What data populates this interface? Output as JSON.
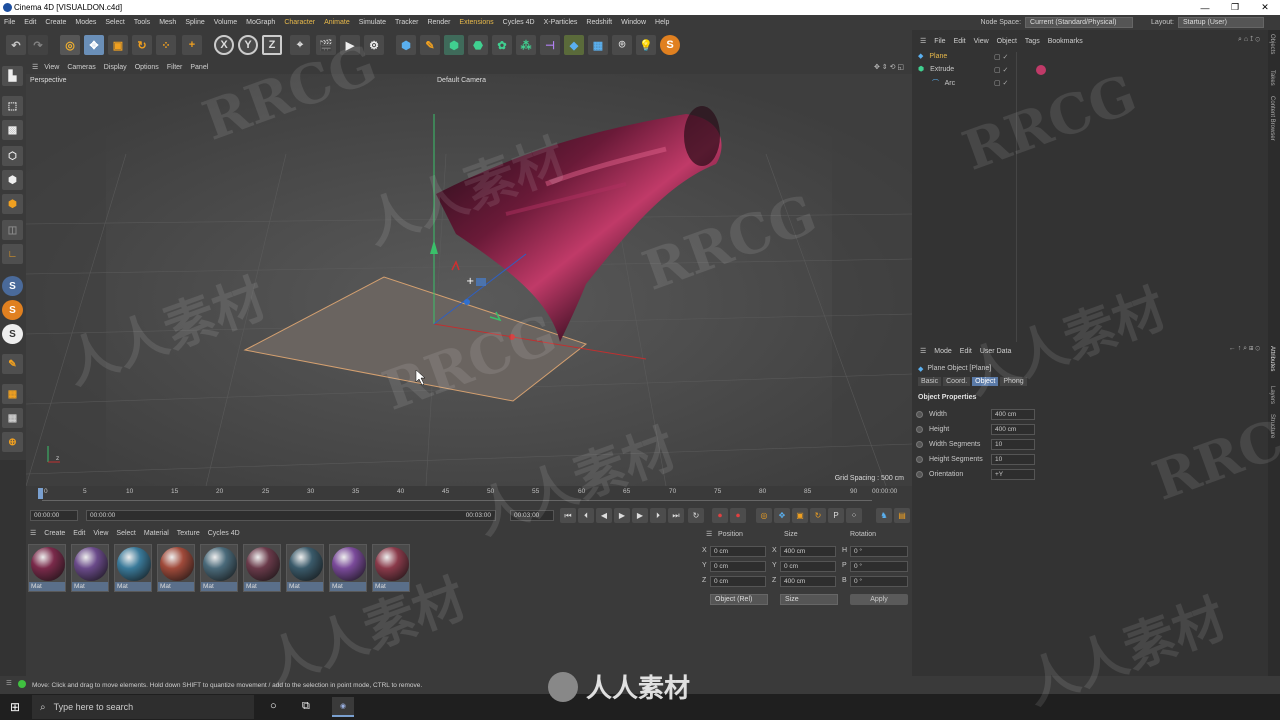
{
  "window": {
    "title": "Cinema 4D [VISUALDON.c4d]",
    "controls": [
      "—",
      "❐",
      "✕"
    ]
  },
  "menubar": {
    "items": [
      "File",
      "Edit",
      "Create",
      "Modes",
      "Select",
      "Tools",
      "Mesh",
      "Spline",
      "Volume",
      "MoGraph",
      "Character",
      "Animate",
      "Simulate",
      "Tracker",
      "Render",
      "Extensions",
      "Cycles 4D",
      "X-Particles",
      "Redshift",
      "Window",
      "Help"
    ],
    "node_space_label": "Node Space:",
    "node_space_value": "Current (Standard/Physical)",
    "layout_label": "Layout:",
    "layout_value": "Startup (User)"
  },
  "toolbar": {
    "axis_x": "X",
    "axis_y": "Y",
    "axis_z": "Z"
  },
  "viewport": {
    "menu": [
      "View",
      "Cameras",
      "Display",
      "Options",
      "Filter",
      "Panel"
    ],
    "projection": "Perspective",
    "camera": "Default Camera",
    "grid_spacing": "Grid Spacing : 500 cm"
  },
  "timeline": {
    "ticks": [
      "0",
      "5",
      "10",
      "15",
      "20",
      "25",
      "30",
      "35",
      "40",
      "45",
      "50",
      "55",
      "60",
      "65",
      "70",
      "75",
      "80",
      "85",
      "90"
    ],
    "end_time": "00:00:00"
  },
  "transport": {
    "current": "00:00:00",
    "start": "00:00:00",
    "end_a": "00:03:00",
    "end_b": "00:03:00"
  },
  "material_manager": {
    "menu": [
      "Create",
      "Edit",
      "View",
      "Select",
      "Material",
      "Texture",
      "Cycles 4D"
    ],
    "materials": [
      {
        "label": "Mat",
        "color": "#7a2a4a"
      },
      {
        "label": "Mat",
        "color": "#6a4a8a"
      },
      {
        "label": "Mat",
        "color": "#3a7a9a"
      },
      {
        "label": "Mat",
        "color": "#a04a3a"
      },
      {
        "label": "Mat",
        "color": "#4a6a7a"
      },
      {
        "label": "Mat",
        "color": "#6a3a4a"
      },
      {
        "label": "Mat",
        "color": "#3a5a6a"
      },
      {
        "label": "Mat",
        "color": "#7a4a9a"
      },
      {
        "label": "Mat",
        "color": "#8a3a4a"
      }
    ]
  },
  "coordinates": {
    "headers": [
      "Position",
      "Size",
      "Rotation"
    ],
    "rows": [
      {
        "axis": "X",
        "pos": "0 cm",
        "size_axis": "X",
        "size": "400 cm",
        "rot_axis": "H",
        "rot": "0 °"
      },
      {
        "axis": "Y",
        "pos": "0 cm",
        "size_axis": "Y",
        "size": "0 cm",
        "rot_axis": "P",
        "rot": "0 °"
      },
      {
        "axis": "Z",
        "pos": "0 cm",
        "size_axis": "Z",
        "size": "400 cm",
        "rot_axis": "B",
        "rot": "0 °"
      }
    ],
    "mode": "Object (Rel)",
    "size_mode": "Size",
    "apply": "Apply"
  },
  "object_manager": {
    "menu": [
      "File",
      "Edit",
      "View",
      "Object",
      "Tags",
      "Bookmarks"
    ],
    "objects": [
      "Plane",
      "Extrude",
      "Arc"
    ]
  },
  "attribute_manager": {
    "menu": [
      "Mode",
      "Edit",
      "User Data"
    ],
    "object_title": "Plane Object [Plane]",
    "tabs": [
      "Basic",
      "Coord.",
      "Object",
      "Phong"
    ],
    "section": "Object Properties",
    "fields": [
      {
        "label": "Width",
        "value": "400 cm"
      },
      {
        "label": "Height",
        "value": "400 cm"
      },
      {
        "label": "Width Segments",
        "value": "10"
      },
      {
        "label": "Height Segments",
        "value": "10"
      },
      {
        "label": "Orientation",
        "value": "+Y"
      }
    ]
  },
  "side_tabs": [
    "Objects",
    "Takes",
    "Content Browser",
    "Attributes",
    "Layers",
    "Structure"
  ],
  "status": "Move: Click and drag to move elements. Hold down SHIFT to quantize movement / add to the selection in point mode, CTRL to remove.",
  "taskbar": {
    "search_placeholder": "Type here to search"
  },
  "watermarks": [
    "RRCG",
    "人人素材",
    "人人素材"
  ]
}
